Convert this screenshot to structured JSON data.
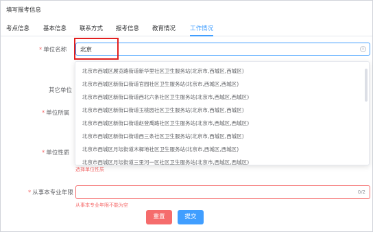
{
  "header": {
    "title": "填写报考信息"
  },
  "tabs": [
    {
      "label": "考点信息"
    },
    {
      "label": "基本信息"
    },
    {
      "label": "联系方式"
    },
    {
      "label": "报考信息"
    },
    {
      "label": "教育情况"
    },
    {
      "label": "工作情况"
    }
  ],
  "active_tab": "工作情况",
  "form": {
    "unit_name": {
      "label": "单位名称",
      "value": "北京"
    },
    "other_unit": {
      "label": "其它单位"
    },
    "unit_affiliation": {
      "label": "单位所属"
    },
    "unit_nature": {
      "label": "单位性质",
      "error": "选择单位性质"
    },
    "years": {
      "label": "从事本专业年限",
      "counter": "0/2",
      "error": "从事本专业年限不能为空"
    }
  },
  "suggestions": [
    "北京市西城区展览路街道新华里社区卫生服务站(北京市,西城区,西城区)",
    "北京市西城区新街口街道官园社区卫生服务站(北京市,西城区,西城区)",
    "北京市西城区新街口街道西北六条社区卫生服务站(北京市,西城区,西城区)",
    "北京市西城区新街口街道玉桃园社区卫生服务站(北京市,西城区,西城区)",
    "北京市西城区新街口街道赵登禹路社区卫生服务站(北京市,西城区,西城区)",
    "北京市西城区新街口街道西三条社区卫生服务站(北京市,西城区,西城区)",
    "北京市西城区月坛街道木樨地社区卫生服务站(北京市,西城区,西城区)",
    "北京市西城区月坛街道三里河一区社区卫生服务站(北京市,西城区,西城区)"
  ],
  "buttons": {
    "reset": "重置",
    "submit": "提交"
  },
  "colors": {
    "accent": "#409eff",
    "danger": "#f56c6c",
    "highlight_box": "#e21e1e"
  }
}
